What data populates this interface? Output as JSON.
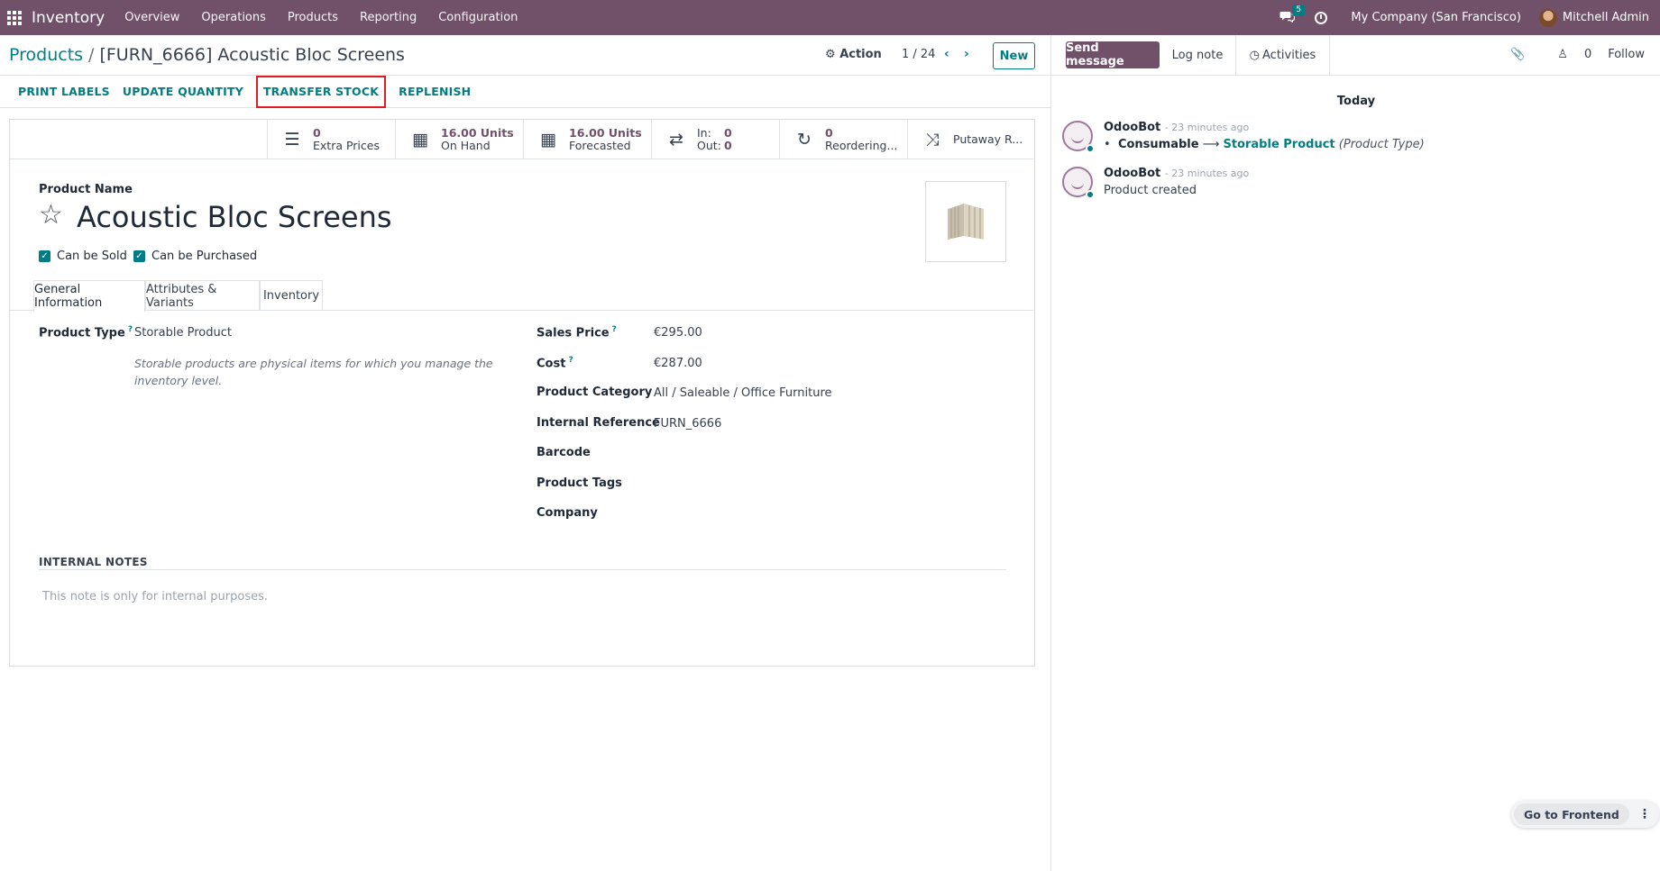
{
  "topbar": {
    "app_name": "Inventory",
    "menu": [
      "Overview",
      "Operations",
      "Products",
      "Reporting",
      "Configuration"
    ],
    "chat_count": "5",
    "company": "My Company (San Francisco)",
    "user": "Mitchell Admin"
  },
  "control": {
    "breadcrumb_parent": "Products",
    "breadcrumb_current": "[FURN_6666] Acoustic Bloc Screens",
    "action_label": "Action",
    "pager": "1 / 24",
    "new_label": "New"
  },
  "action_buttons": [
    "PRINT LABELS",
    "UPDATE QUANTITY",
    "TRANSFER STOCK",
    "REPLENISH"
  ],
  "stats": {
    "extra_prices_value": "0",
    "extra_prices_label": "Extra Prices",
    "on_hand_value": "16.00 Units",
    "on_hand_label": "On Hand",
    "forecasted_value": "16.00 Units",
    "forecasted_label": "Forecasted",
    "in_label": "In:",
    "in_value": "0",
    "out_label": "Out:",
    "out_value": "0",
    "reordering_value": "0",
    "reordering_label": "Reordering...",
    "putaway_label": "Putaway R..."
  },
  "product": {
    "name_label": "Product Name",
    "name": "Acoustic Bloc Screens",
    "can_be_sold": "Can be Sold",
    "can_be_purchased": "Can be Purchased"
  },
  "tabs": [
    "General Information",
    "Attributes & Variants",
    "Inventory"
  ],
  "fields": {
    "product_type_label": "Product Type",
    "product_type_value": "Storable Product",
    "product_type_help": "Storable products are physical items for which you manage the inventory level.",
    "sales_price_label": "Sales Price",
    "sales_price_value": "€295.00",
    "cost_label": "Cost",
    "cost_value": "€287.00",
    "category_label": "Product Category",
    "category_value": "All / Saleable / Office Furniture",
    "internal_ref_label": "Internal Reference",
    "internal_ref_value": "FURN_6666",
    "barcode_label": "Barcode",
    "tags_label": "Product Tags",
    "company_label": "Company",
    "help_mark": "?"
  },
  "notes": {
    "heading": "INTERNAL NOTES",
    "placeholder": "This note is only for internal purposes."
  },
  "chatter": {
    "send_message": "Send message",
    "log_note": "Log note",
    "activities": "Activities",
    "followers_count": "0",
    "follow": "Follow",
    "today": "Today",
    "messages": [
      {
        "author": "OdooBot",
        "when": "- 23 minutes ago",
        "old_value": "Consumable",
        "new_value": "Storable Product",
        "field": "(Product Type)"
      },
      {
        "author": "OdooBot",
        "when": "- 23 minutes ago",
        "body": "Product created"
      }
    ]
  },
  "frontend": {
    "label": "Go to Frontend"
  },
  "colors": {
    "brand": "#71506a",
    "accent": "#017e84",
    "highlight": "#e01b24"
  }
}
